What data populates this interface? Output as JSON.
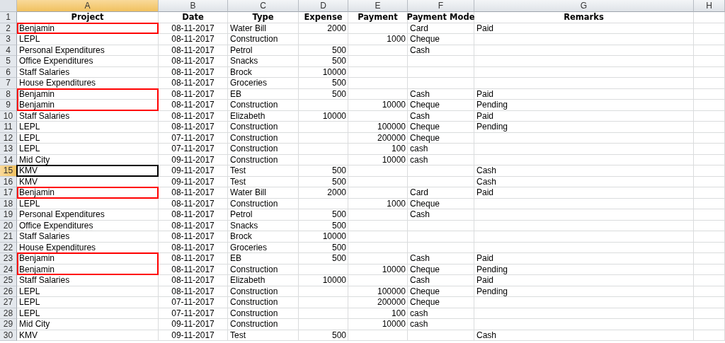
{
  "columns": [
    {
      "letter": "A",
      "selected": true
    },
    {
      "letter": "B",
      "selected": false
    },
    {
      "letter": "C",
      "selected": false
    },
    {
      "letter": "D",
      "selected": false
    },
    {
      "letter": "E",
      "selected": false
    },
    {
      "letter": "F",
      "selected": false
    },
    {
      "letter": "G",
      "selected": false
    },
    {
      "letter": "H",
      "selected": false
    }
  ],
  "header": {
    "number": "1",
    "project": "Project",
    "date": "Date",
    "type": "Type",
    "expense": "Expense",
    "payment": "Payment",
    "payment_mode": "Payment Mode",
    "remarks": "Remarks"
  },
  "rows": [
    {
      "number": "2",
      "project": "Benjamin",
      "date": "08-11-2017",
      "type": "Water Bill",
      "expense": "2000",
      "payment_mode": "Card",
      "remarks": "Paid",
      "marked": true,
      "selected": false
    },
    {
      "number": "3",
      "project": "LEPL",
      "date": "08-11-2017",
      "type": "Construction",
      "payment": "1000",
      "payment_mode": "Cheque",
      "marked": false,
      "selected": false
    },
    {
      "number": "4",
      "project": "Personal Expenditures",
      "date": "08-11-2017",
      "type": "Petrol",
      "expense": "500",
      "payment_mode": "Cash",
      "marked": false,
      "selected": false
    },
    {
      "number": "5",
      "project": "Office Expenditures",
      "date": "08-11-2017",
      "type": "Snacks",
      "expense": "500",
      "marked": false,
      "selected": false
    },
    {
      "number": "6",
      "project": "Staff Salaries",
      "date": "08-11-2017",
      "type": "Brock",
      "expense": "10000",
      "marked": false,
      "selected": false
    },
    {
      "number": "7",
      "project": "House Expenditures",
      "date": "08-11-2017",
      "type": "Groceries",
      "expense": "500",
      "marked": false,
      "selected": false
    },
    {
      "number": "8",
      "project": "Benjamin",
      "date": "08-11-2017",
      "type": "EB",
      "expense": "500",
      "payment_mode": "Cash",
      "remarks": "Paid",
      "marked": true,
      "selected": false
    },
    {
      "number": "9",
      "project": "Benjamin",
      "date": "08-11-2017",
      "type": "Construction",
      "payment": "10000",
      "payment_mode": "Cheque",
      "remarks": "Pending",
      "marked": true,
      "selected": false
    },
    {
      "number": "10",
      "project": "Staff Salaries",
      "date": "08-11-2017",
      "type": "Elizabeth",
      "expense": "10000",
      "payment_mode": "Cash",
      "remarks": "Paid",
      "marked": false,
      "selected": false
    },
    {
      "number": "11",
      "project": "LEPL",
      "date": "08-11-2017",
      "type": "Construction",
      "payment": "100000",
      "payment_mode": "Cheque",
      "remarks": "Pending",
      "marked": false,
      "selected": false
    },
    {
      "number": "12",
      "project": "LEPL",
      "date": "07-11-2017",
      "type": "Construction",
      "payment": "200000",
      "payment_mode": "Cheque",
      "marked": false,
      "selected": false
    },
    {
      "number": "13",
      "project": "LEPL",
      "date": "07-11-2017",
      "type": "Construction",
      "payment": "100",
      "payment_mode": "cash",
      "marked": false,
      "selected": false
    },
    {
      "number": "14",
      "project": "Mid City",
      "date": "09-11-2017",
      "type": "Construction",
      "payment": "10000",
      "payment_mode": "cash",
      "marked": false,
      "selected": false
    },
    {
      "number": "15",
      "project": "KMV",
      "date": "09-11-2017",
      "type": "Test",
      "expense": "500",
      "remarks": "Cash",
      "marked": false,
      "selected": true
    },
    {
      "number": "16",
      "project": "KMV",
      "date": "09-11-2017",
      "type": "Test",
      "expense": "500",
      "remarks": "Cash",
      "marked": false,
      "selected": false
    },
    {
      "number": "17",
      "project": "Benjamin",
      "date": "08-11-2017",
      "type": "Water Bill",
      "expense": "2000",
      "payment_mode": "Card",
      "remarks": "Paid",
      "marked": true,
      "selected": false
    },
    {
      "number": "18",
      "project": "LEPL",
      "date": "08-11-2017",
      "type": "Construction",
      "payment": "1000",
      "payment_mode": "Cheque",
      "marked": false,
      "selected": false
    },
    {
      "number": "19",
      "project": "Personal Expenditures",
      "date": "08-11-2017",
      "type": "Petrol",
      "expense": "500",
      "payment_mode": "Cash",
      "marked": false,
      "selected": false
    },
    {
      "number": "20",
      "project": "Office Expenditures",
      "date": "08-11-2017",
      "type": "Snacks",
      "expense": "500",
      "marked": false,
      "selected": false
    },
    {
      "number": "21",
      "project": "Staff Salaries",
      "date": "08-11-2017",
      "type": "Brock",
      "expense": "10000",
      "marked": false,
      "selected": false
    },
    {
      "number": "22",
      "project": "House Expenditures",
      "date": "08-11-2017",
      "type": "Groceries",
      "expense": "500",
      "marked": false,
      "selected": false
    },
    {
      "number": "23",
      "project": "Benjamin",
      "date": "08-11-2017",
      "type": "EB",
      "expense": "500",
      "payment_mode": "Cash",
      "remarks": "Paid",
      "marked": true,
      "selected": false
    },
    {
      "number": "24",
      "project": "Benjamin",
      "date": "08-11-2017",
      "type": "Construction",
      "payment": "10000",
      "payment_mode": "Cheque",
      "remarks": "Pending",
      "marked": true,
      "selected": false
    },
    {
      "number": "25",
      "project": "Staff Salaries",
      "date": "08-11-2017",
      "type": "Elizabeth",
      "expense": "10000",
      "payment_mode": "Cash",
      "remarks": "Paid",
      "marked": false,
      "selected": false
    },
    {
      "number": "26",
      "project": "LEPL",
      "date": "08-11-2017",
      "type": "Construction",
      "payment": "100000",
      "payment_mode": "Cheque",
      "remarks": "Pending",
      "marked": false,
      "selected": false
    },
    {
      "number": "27",
      "project": "LEPL",
      "date": "07-11-2017",
      "type": "Construction",
      "payment": "200000",
      "payment_mode": "Cheque",
      "marked": false,
      "selected": false
    },
    {
      "number": "28",
      "project": "LEPL",
      "date": "07-11-2017",
      "type": "Construction",
      "payment": "100",
      "payment_mode": "cash",
      "marked": false,
      "selected": false
    },
    {
      "number": "29",
      "project": "Mid City",
      "date": "09-11-2017",
      "type": "Construction",
      "payment": "10000",
      "payment_mode": "cash",
      "marked": false,
      "selected": false
    },
    {
      "number": "30",
      "project": "KMV",
      "date": "09-11-2017",
      "type": "Test",
      "expense": "500",
      "remarks": "Cash",
      "marked": false,
      "selected": false
    }
  ]
}
